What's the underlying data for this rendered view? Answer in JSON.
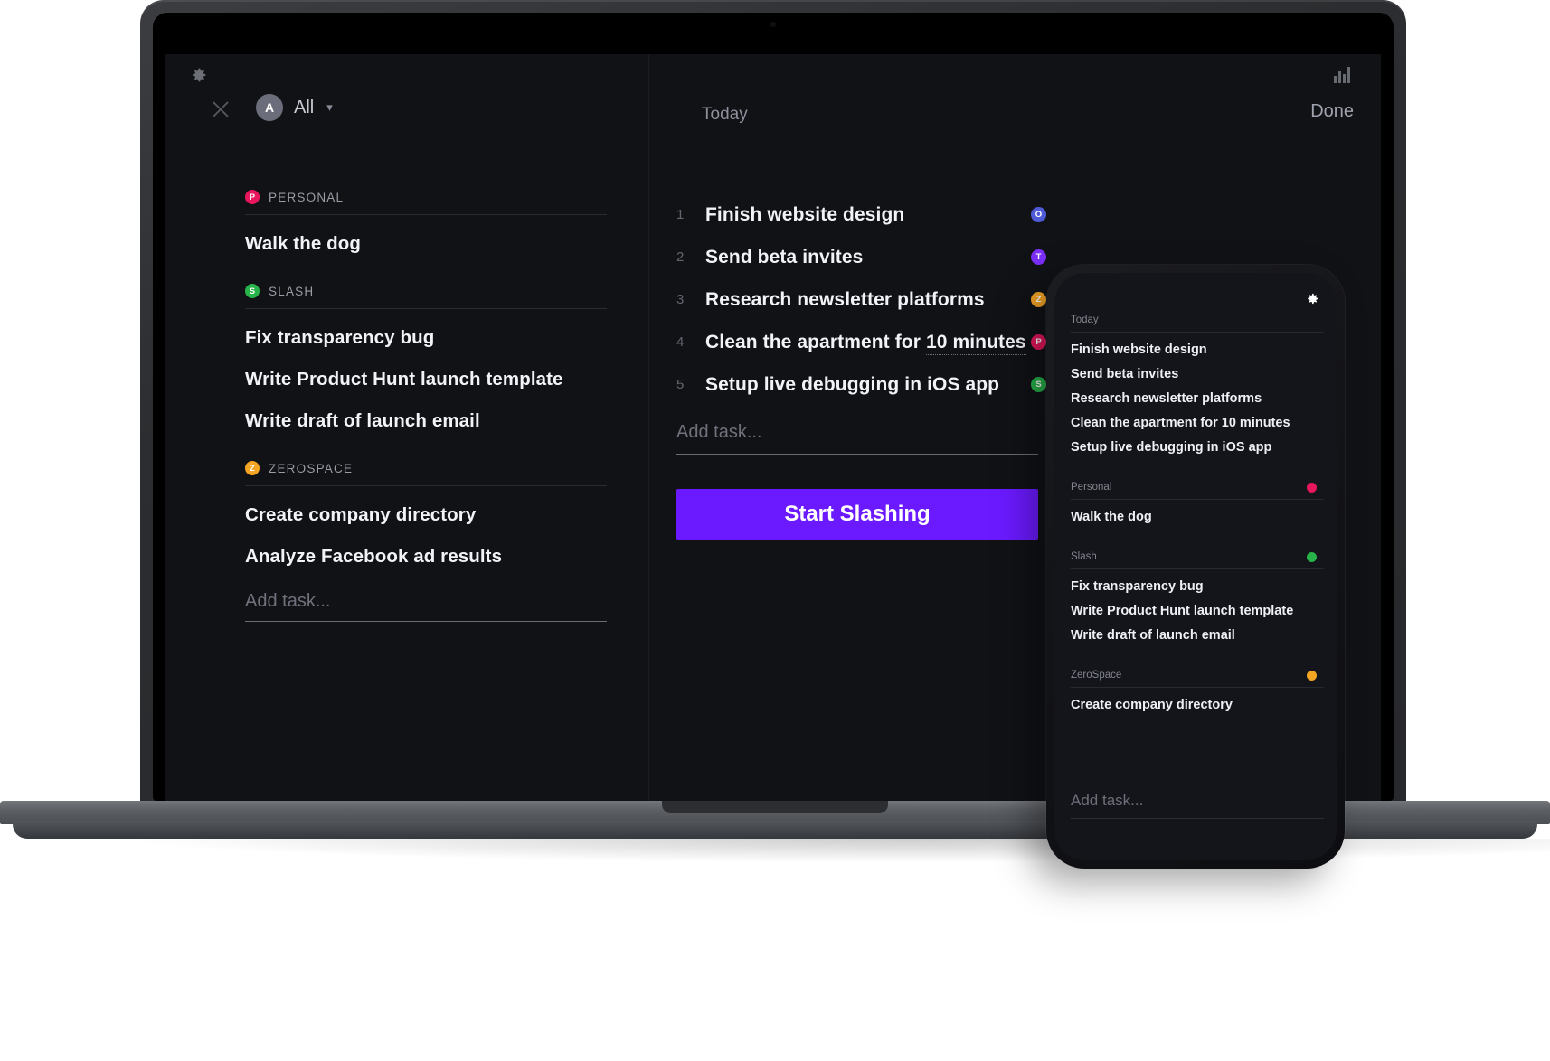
{
  "colors": {
    "accent": "#6b1aff",
    "personal": "#e8175d",
    "slash": "#27b34a",
    "zerospace": "#f5a524",
    "overhaul": "#4f5ad6",
    "teams": "#7b2ff7",
    "bg": "#111216",
    "phone_bg": "#13151a"
  },
  "desktop": {
    "sidebar": {
      "gear_icon": "gear-icon",
      "close_icon": "close-icon",
      "account": {
        "avatar_letter": "A",
        "label": "All",
        "chevron": "chevron-down-icon"
      },
      "groups": [
        {
          "name": "PERSONAL",
          "badge": "P",
          "color": "#e8175d",
          "tasks": [
            "Walk the dog"
          ]
        },
        {
          "name": "SLASH",
          "badge": "S",
          "color": "#27b34a",
          "tasks": [
            "Fix transparency bug",
            "Write Product Hunt launch template",
            "Write draft of launch email"
          ]
        },
        {
          "name": "ZEROSPACE",
          "badge": "Z",
          "color": "#f5a524",
          "tasks": [
            "Create company directory",
            "Analyze Facebook ad results"
          ]
        }
      ],
      "add_task_placeholder": "Add task..."
    },
    "today": {
      "header_label": "Today",
      "done_label": "Done",
      "stats_icon": "bar-chart-icon",
      "tasks": [
        {
          "num": "1",
          "text": "Finish website design",
          "badge": "O",
          "color": "#4f5ad6",
          "dotted": false
        },
        {
          "num": "2",
          "text": "Send beta invites",
          "badge": "T",
          "color": "#7b2ff7",
          "dotted": false
        },
        {
          "num": "3",
          "text": "Research newsletter platforms",
          "badge": "Z",
          "color": "#f5a524",
          "dotted": false
        },
        {
          "num": "4",
          "text": "Clean the apartment for ",
          "dotted_text": "10 minutes",
          "badge": "P",
          "color": "#e8175d",
          "dotted": true
        },
        {
          "num": "5",
          "text": "Setup live debugging in iOS app",
          "badge": "S",
          "color": "#27b34a",
          "dotted": false
        }
      ],
      "add_task_placeholder": "Add task...",
      "start_button_label": "Start Slashing"
    }
  },
  "phone": {
    "gear_icon": "gear-icon",
    "groups": [
      {
        "name": "Today",
        "dot_color": null,
        "tasks": [
          "Finish website design",
          "Send beta invites",
          "Research newsletter platforms",
          "Clean the apartment for 10 minutes",
          "Setup live debugging in iOS app"
        ]
      },
      {
        "name": "Personal",
        "dot_color": "#e8175d",
        "tasks": [
          "Walk the dog"
        ]
      },
      {
        "name": "Slash",
        "dot_color": "#27b34a",
        "tasks": [
          "Fix transparency bug",
          "Write Product Hunt launch template",
          "Write draft of launch email"
        ]
      },
      {
        "name": "ZeroSpace",
        "dot_color": "#f5a524",
        "tasks": [
          "Create company directory"
        ]
      }
    ],
    "add_task_placeholder": "Add task..."
  }
}
